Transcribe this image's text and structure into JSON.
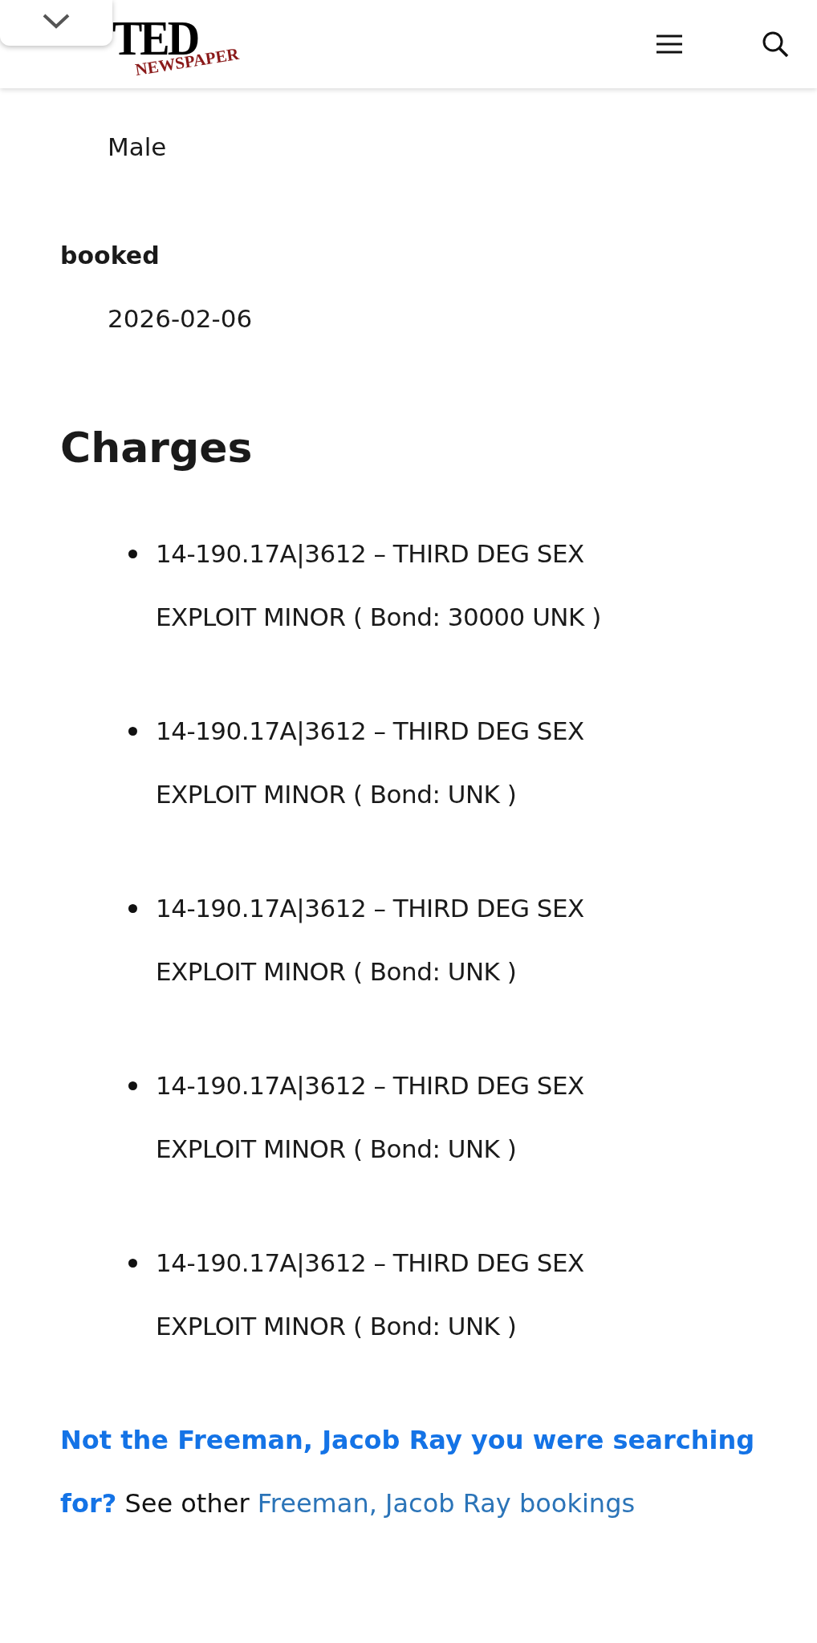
{
  "header": {
    "logo_text": "TED",
    "logo_subtext": "NEWSPAPER"
  },
  "fields": [
    {
      "label": "booked",
      "value": "2026-02-06"
    }
  ],
  "top_value": "Male",
  "charges_heading": "Charges",
  "charges": [
    {
      "text": "14-190.17A|3612 – THIRD DEG SEX EXPLOIT MINOR ( Bond: 30000 UNK )"
    },
    {
      "text": "14-190.17A|3612 – THIRD DEG SEX EXPLOIT MINOR ( Bond: UNK )"
    },
    {
      "text": "14-190.17A|3612 – THIRD DEG SEX EXPLOIT MINOR ( Bond: UNK )"
    },
    {
      "text": "14-190.17A|3612 – THIRD DEG SEX EXPLOIT MINOR ( Bond: UNK )"
    },
    {
      "text": "14-190.17A|3612 – THIRD DEG SEX EXPLOIT MINOR ( Bond: UNK )"
    }
  ],
  "footer_note": {
    "question": "Not the Freeman, Jacob Ray you were searching for?",
    "text": "See other",
    "link": "Freeman, Jacob Ray bookings"
  }
}
